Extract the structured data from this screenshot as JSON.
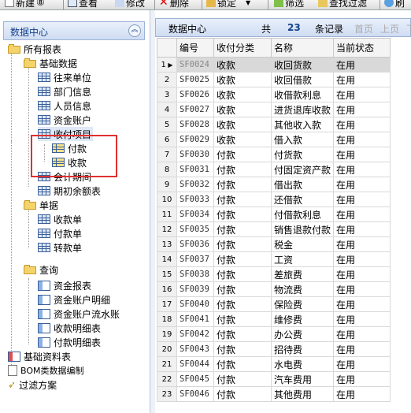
{
  "toolbar": {
    "buttons": [
      {
        "label": "新建",
        "shortcut": "⑧"
      },
      {
        "label": "查看"
      },
      {
        "label": "修改"
      },
      {
        "label": "删除"
      },
      {
        "label": "锁定"
      },
      {
        "label": "筛选"
      },
      {
        "label": "查找过滤"
      },
      {
        "label": "刷"
      }
    ]
  },
  "left_panel": {
    "title": "数据中心",
    "tree": [
      {
        "label": "所有报表"
      },
      {
        "label": "基础数据"
      },
      {
        "label": "往来单位"
      },
      {
        "label": "部门信息"
      },
      {
        "label": "人员信息"
      },
      {
        "label": "资金账户"
      },
      {
        "label": "收付项目"
      },
      {
        "label": "付款"
      },
      {
        "label": "收款"
      },
      {
        "label": "会计期间"
      },
      {
        "label": "期初余额表"
      },
      {
        "label": "单据"
      },
      {
        "label": "收款单"
      },
      {
        "label": "付款单"
      },
      {
        "label": "转款单"
      },
      {
        "label": "查询"
      },
      {
        "label": "资金报表"
      },
      {
        "label": "资金账户明细"
      },
      {
        "label": "资金账户流水账"
      },
      {
        "label": "收款明细表"
      },
      {
        "label": "付款明细表"
      },
      {
        "label": "基础资料表"
      },
      {
        "label": "BOM类数据编制"
      },
      {
        "label": "过滤方案"
      }
    ]
  },
  "pager": {
    "title": "数据中心",
    "total_prefix": "共",
    "total": "23",
    "total_suffix": "条记录",
    "first": "首页",
    "prev": "上页",
    "next": "下"
  },
  "table": {
    "headers": [
      "编号",
      "收付分类",
      "名称",
      "当前状态"
    ],
    "rows": [
      [
        "1",
        "SF0024",
        "收款",
        "收回货款",
        "在用"
      ],
      [
        "2",
        "SF0025",
        "收款",
        "收回借款",
        "在用"
      ],
      [
        "3",
        "SF0026",
        "收款",
        "收借款利息",
        "在用"
      ],
      [
        "4",
        "SF0027",
        "收款",
        "进货退库收款",
        "在用"
      ],
      [
        "5",
        "SF0028",
        "收款",
        "其他收入款",
        "在用"
      ],
      [
        "6",
        "SF0029",
        "收款",
        "借入款",
        "在用"
      ],
      [
        "7",
        "SF0030",
        "付款",
        "付货款",
        "在用"
      ],
      [
        "8",
        "SF0031",
        "付款",
        "付固定资产款",
        "在用"
      ],
      [
        "9",
        "SF0032",
        "付款",
        "借出款",
        "在用"
      ],
      [
        "10",
        "SF0033",
        "付款",
        "还借款",
        "在用"
      ],
      [
        "11",
        "SF0034",
        "付款",
        "付借款利息",
        "在用"
      ],
      [
        "12",
        "SF0035",
        "付款",
        "销售退款付款",
        "在用"
      ],
      [
        "13",
        "SF0036",
        "付款",
        "税金",
        "在用"
      ],
      [
        "14",
        "SF0037",
        "付款",
        "工资",
        "在用"
      ],
      [
        "15",
        "SF0038",
        "付款",
        "差旅费",
        "在用"
      ],
      [
        "16",
        "SF0039",
        "付款",
        "物流费",
        "在用"
      ],
      [
        "17",
        "SF0040",
        "付款",
        "保险费",
        "在用"
      ],
      [
        "18",
        "SF0041",
        "付款",
        "维修费",
        "在用"
      ],
      [
        "19",
        "SF0042",
        "付款",
        "办公费",
        "在用"
      ],
      [
        "20",
        "SF0043",
        "付款",
        "招待费",
        "在用"
      ],
      [
        "21",
        "SF0044",
        "付款",
        "水电费",
        "在用"
      ],
      [
        "22",
        "SF0045",
        "付款",
        "汽车费用",
        "在用"
      ],
      [
        "23",
        "SF0046",
        "付款",
        "其他费用",
        "在用"
      ]
    ]
  }
}
